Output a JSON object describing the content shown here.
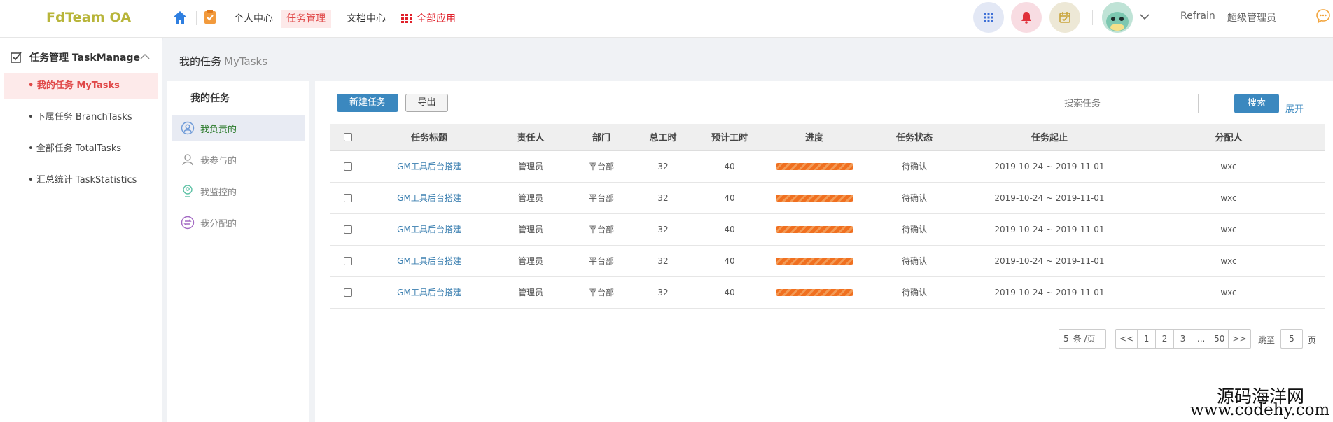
{
  "header": {
    "logo": "FdTeam OA",
    "nav": {
      "personal": "个人中心",
      "task": "任务管理",
      "doc": "文档中心",
      "all_apps": "全部应用"
    },
    "user_name": "Refrain",
    "user_role": "超级管理员",
    "icons": [
      "home-icon",
      "clipboard-icon",
      "apps-icon",
      "bell-icon",
      "calendar-icon",
      "chevron-down-icon",
      "chat-icon"
    ],
    "colors": {
      "logo": "#b8b53a",
      "active_nav": "#e04848",
      "all_apps": "#e0202a"
    }
  },
  "sidebar": {
    "group_label": "任务管理 TaskManage",
    "items": [
      {
        "label": "• 我的任务 MyTasks"
      },
      {
        "label": "• 下属任务 BranchTasks"
      },
      {
        "label": "• 全部任务 TotalTasks"
      },
      {
        "label": "• 汇总统计 TaskStatistics"
      }
    ]
  },
  "breadcrumb": {
    "cn": "我的任务",
    "en": "MyTasks"
  },
  "subnav": {
    "title": "我的任务",
    "items": [
      {
        "label": "我负责的"
      },
      {
        "label": "我参与的"
      },
      {
        "label": "我监控的"
      },
      {
        "label": "我分配的"
      }
    ]
  },
  "toolbar": {
    "new_task": "新建任务",
    "export": "导出",
    "search_placeholder": "搜索任务",
    "search": "搜索",
    "expand": "展开"
  },
  "table": {
    "headers": [
      "任务标题",
      "责任人",
      "部门",
      "总工时",
      "预计工时",
      "进度",
      "任务状态",
      "任务起止",
      "分配人"
    ],
    "rows": [
      {
        "title": "GM工具后台搭建",
        "owner": "管理员",
        "dept": "平台部",
        "total": "32",
        "est": "40",
        "progress": 1.0,
        "status": "待确认",
        "period": "2019-10-24 ~ 2019-11-01",
        "assigner": "wxc"
      },
      {
        "title": "GM工具后台搭建",
        "owner": "管理员",
        "dept": "平台部",
        "total": "32",
        "est": "40",
        "progress": 1.0,
        "status": "待确认",
        "period": "2019-10-24 ~ 2019-11-01",
        "assigner": "wxc"
      },
      {
        "title": "GM工具后台搭建",
        "owner": "管理员",
        "dept": "平台部",
        "total": "32",
        "est": "40",
        "progress": 1.0,
        "status": "待确认",
        "period": "2019-10-24 ~ 2019-11-01",
        "assigner": "wxc"
      },
      {
        "title": "GM工具后台搭建",
        "owner": "管理员",
        "dept": "平台部",
        "total": "32",
        "est": "40",
        "progress": 1.0,
        "status": "待确认",
        "period": "2019-10-24 ~ 2019-11-01",
        "assigner": "wxc"
      },
      {
        "title": "GM工具后台搭建",
        "owner": "管理员",
        "dept": "平台部",
        "total": "32",
        "est": "40",
        "progress": 1.0,
        "status": "待确认",
        "period": "2019-10-24 ~ 2019-11-01",
        "assigner": "wxc"
      }
    ]
  },
  "pager": {
    "page_size": "5",
    "page_size_unit": "条 /页",
    "buttons": [
      "<<",
      "1",
      "2",
      "3",
      "...",
      "50",
      ">>"
    ],
    "jump_label": "跳至",
    "jump_value": "5",
    "jump_unit": "页"
  },
  "watermark": {
    "cn": "源码海洋网",
    "url": "www.codehy.com"
  }
}
